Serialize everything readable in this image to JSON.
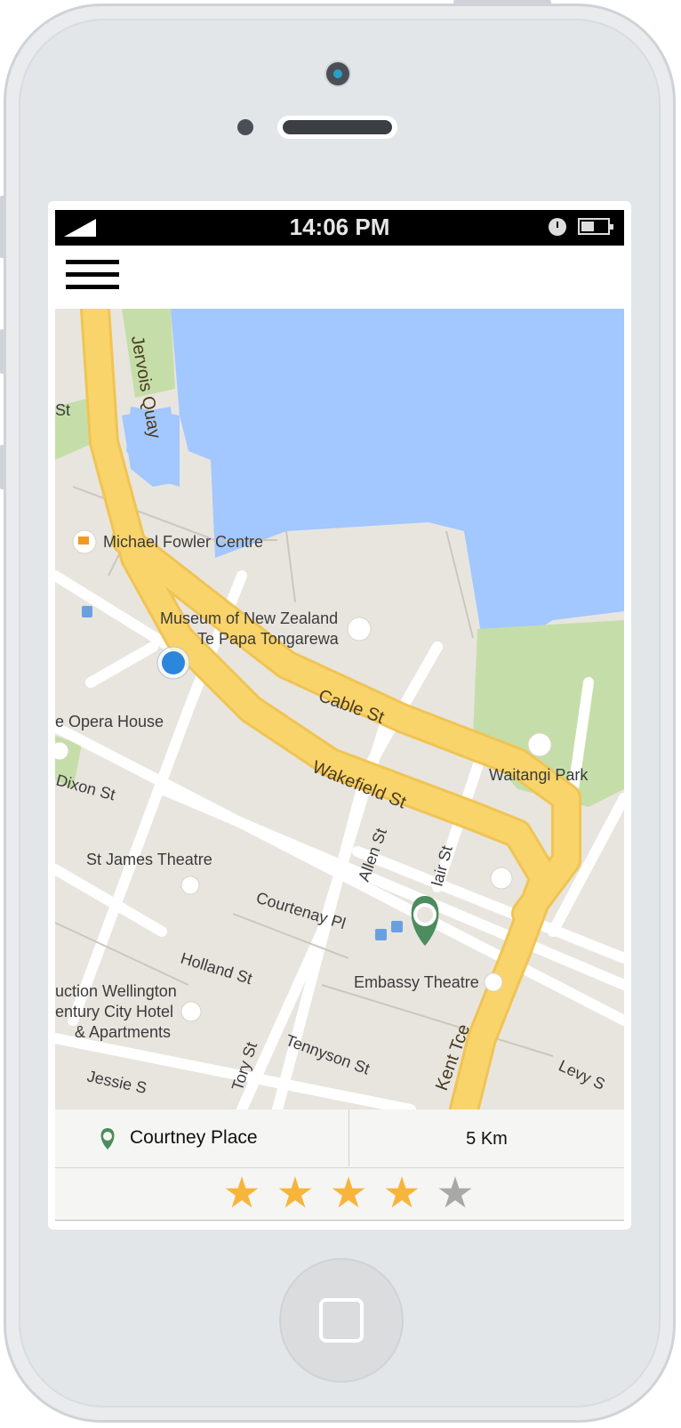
{
  "status_bar": {
    "time": "14:06 PM"
  },
  "map": {
    "labels": {
      "quay": "Jervois Quay",
      "st": "St",
      "fowler": "Michael Fowler Centre",
      "museum_line1": "Museum of New Zealand",
      "museum_line2": "Te Papa Tongarewa",
      "cable": "Cable St",
      "wakefield": "Wakefield St",
      "waitangi": "Waitangi Park",
      "opera": "e Opera House",
      "dixon": "Dixon St",
      "st_james": "St James Theatre",
      "courtenay": "Courtenay Pl",
      "allen": "Allen St",
      "blair": "lair St",
      "embassy": "Embassy Theatre",
      "holland": "Holland St",
      "wellington_line1": "uction Wellington",
      "wellington_line2": "entury City Hotel",
      "wellington_line3": "& Apartments",
      "tory": "Tory St",
      "tennyson": "Tennyson St",
      "kent": "Kent Tce",
      "levy": "Levy S",
      "jessie": "Jessie S"
    }
  },
  "info": {
    "location": "Courtney Place",
    "distance": "5 Km"
  },
  "rating": {
    "value": 4,
    "max": 5
  },
  "colors": {
    "road": "#f9d46a",
    "water": "#a3c7ff",
    "park": "#c5dea9",
    "pin": "#4c8c5e",
    "user_dot": "#2b86dd",
    "star_on": "#f7b53c",
    "star_off": "#a8a8a8"
  }
}
